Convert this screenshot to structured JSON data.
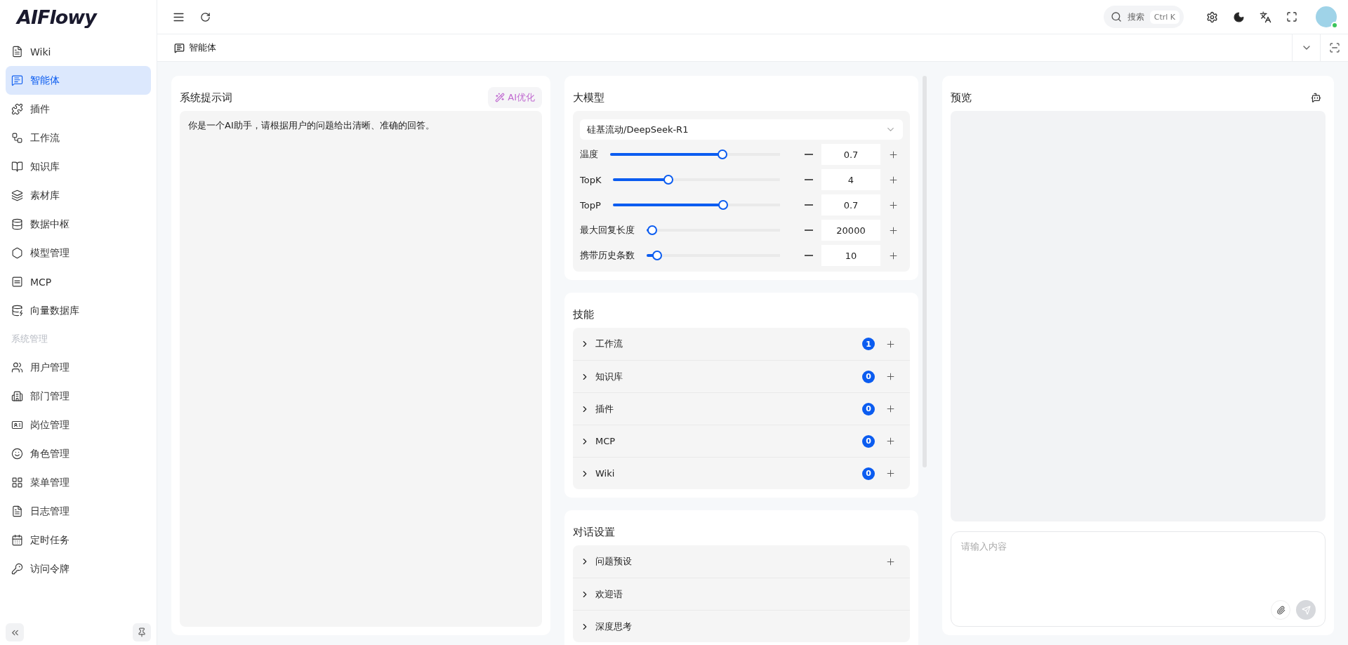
{
  "logo": "AIFlowy",
  "sidebar": {
    "items": [
      {
        "label": "Wiki",
        "selected": false
      },
      {
        "label": "智能体",
        "selected": true
      },
      {
        "label": "插件",
        "selected": false
      },
      {
        "label": "工作流",
        "selected": false
      },
      {
        "label": "知识库",
        "selected": false
      },
      {
        "label": "素材库",
        "selected": false
      },
      {
        "label": "数据中枢",
        "selected": false
      },
      {
        "label": "模型管理",
        "selected": false
      },
      {
        "label": "MCP",
        "selected": false
      },
      {
        "label": "向量数据库",
        "selected": false
      }
    ],
    "section_title": "系统管理",
    "system_items": [
      {
        "label": "用户管理",
        "selected": false
      },
      {
        "label": "部门管理",
        "selected": false
      },
      {
        "label": "岗位管理",
        "selected": false
      },
      {
        "label": "角色管理",
        "selected": false
      },
      {
        "label": "菜单管理",
        "selected": false
      },
      {
        "label": "日志管理",
        "selected": false
      },
      {
        "label": "定时任务",
        "selected": false
      },
      {
        "label": "访问令牌",
        "selected": false
      }
    ]
  },
  "search": {
    "placeholder": "搜索",
    "shortcut": "Ctrl K"
  },
  "tabs": [
    {
      "label": "智能体"
    }
  ],
  "prompt_panel": {
    "title": "系统提示词",
    "optimize_button": "AI优化",
    "text": "你是一个AI助手，请根据用户的问题给出清晰、准确的回答。"
  },
  "model_panel": {
    "title": "大模型",
    "model": "硅基流动/DeepSeek-R1",
    "params": [
      {
        "label": "温度",
        "level": 0.66,
        "value": "0.7"
      },
      {
        "label": "TopK",
        "level": 0.33,
        "value": "4"
      },
      {
        "label": "TopP",
        "level": 0.66,
        "value": "0.7"
      },
      {
        "label": "最大回复长度",
        "level": 0.04,
        "value": "20000"
      },
      {
        "label": "携带历史条数",
        "level": 0.08,
        "value": "10"
      }
    ]
  },
  "skills_panel": {
    "title": "技能",
    "items": [
      {
        "label": "工作流",
        "count": "1"
      },
      {
        "label": "知识库",
        "count": "0"
      },
      {
        "label": "插件",
        "count": "0"
      },
      {
        "label": "MCP",
        "count": "0"
      },
      {
        "label": "Wiki",
        "count": "0"
      }
    ]
  },
  "chat_panel": {
    "title": "对话设置",
    "items": [
      {
        "label": "问题预设",
        "addable": true
      },
      {
        "label": "欢迎语",
        "addable": false
      },
      {
        "label": "深度思考",
        "addable": false
      }
    ]
  },
  "preview": {
    "title": "预览",
    "input_placeholder": "请输入内容"
  }
}
